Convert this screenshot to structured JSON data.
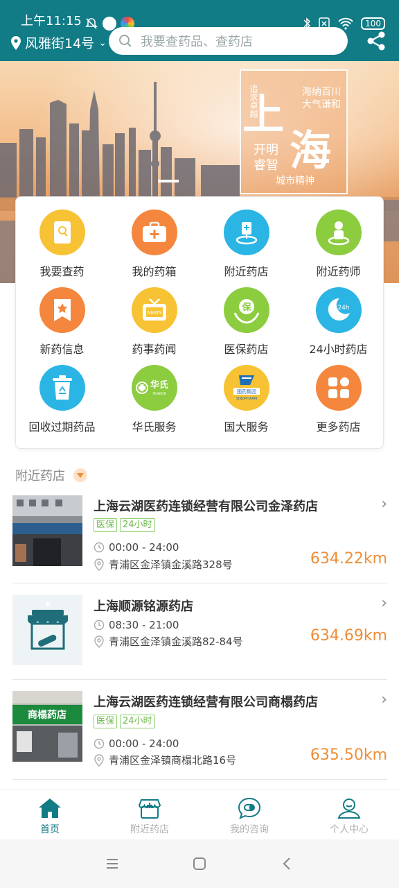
{
  "status": {
    "time": "上午11:15",
    "battery": "100"
  },
  "header": {
    "location": "风雅街14号",
    "search_placeholder": "我要查药品、查药店"
  },
  "banner": {
    "big1": "上",
    "big2": "海",
    "side1": "追求卓越",
    "side2": "海纳百川 大气谦和",
    "side3": "开明 睿智",
    "side4": "城市精神"
  },
  "features": [
    {
      "label": "我要查药",
      "icon": "book-icon",
      "color": "#f7c233"
    },
    {
      "label": "我的药箱",
      "icon": "medicine-box-icon",
      "color": "#f4873d"
    },
    {
      "label": "附近药店",
      "icon": "pharmacy-location-icon",
      "color": "#2ab5e4"
    },
    {
      "label": "附近药师",
      "icon": "pharmacist-location-icon",
      "color": "#8ccc3f"
    },
    {
      "label": "新药信息",
      "icon": "new-drug-icon",
      "color": "#f4873d"
    },
    {
      "label": "药事药闻",
      "icon": "news-tv-icon",
      "color": "#f7c233"
    },
    {
      "label": "医保药店",
      "icon": "insurance-icon",
      "color": "#8ccc3f"
    },
    {
      "label": "24小时药店",
      "icon": "24-hours-icon",
      "color": "#2ab5e4"
    },
    {
      "label": "回收过期药品",
      "icon": "recycle-bin-icon",
      "color": "#2ab5e4"
    },
    {
      "label": "华氏服务",
      "icon": "huashi-logo-icon",
      "color": "#8ccc3f"
    },
    {
      "label": "国大服务",
      "icon": "sinopharm-logo-icon",
      "color": "#f7c233"
    },
    {
      "label": "更多药店",
      "icon": "more-grid-icon",
      "color": "#f4873d"
    }
  ],
  "nearby_title": "附近药店",
  "stores": [
    {
      "name": "上海云湖医药连锁经营有限公司金泽药店",
      "tags": [
        "医保",
        "24小时"
      ],
      "hours": "00:00 - 24:00",
      "address": "青浦区金泽镇金溪路328号",
      "distance": "634.22km"
    },
    {
      "name": "上海顺源铭源药店",
      "tags": [],
      "hours": "08:30 - 21:00",
      "address": "青浦区金泽镇金溪路82-84号",
      "distance": "634.69km"
    },
    {
      "name": "上海云湖医药连锁经营有限公司商榻药店",
      "tags": [
        "医保",
        "24小时"
      ],
      "hours": "00:00 - 24:00",
      "address": "青浦区金泽镇商榻北路16号",
      "distance": "635.50km"
    }
  ],
  "tabs": [
    {
      "label": "首页",
      "icon": "home-icon",
      "active": true
    },
    {
      "label": "附近药店",
      "icon": "pharmacy-icon",
      "active": false
    },
    {
      "label": "我的咨询",
      "icon": "chat-icon",
      "active": false
    },
    {
      "label": "个人中心",
      "icon": "user-icon",
      "active": false
    }
  ]
}
